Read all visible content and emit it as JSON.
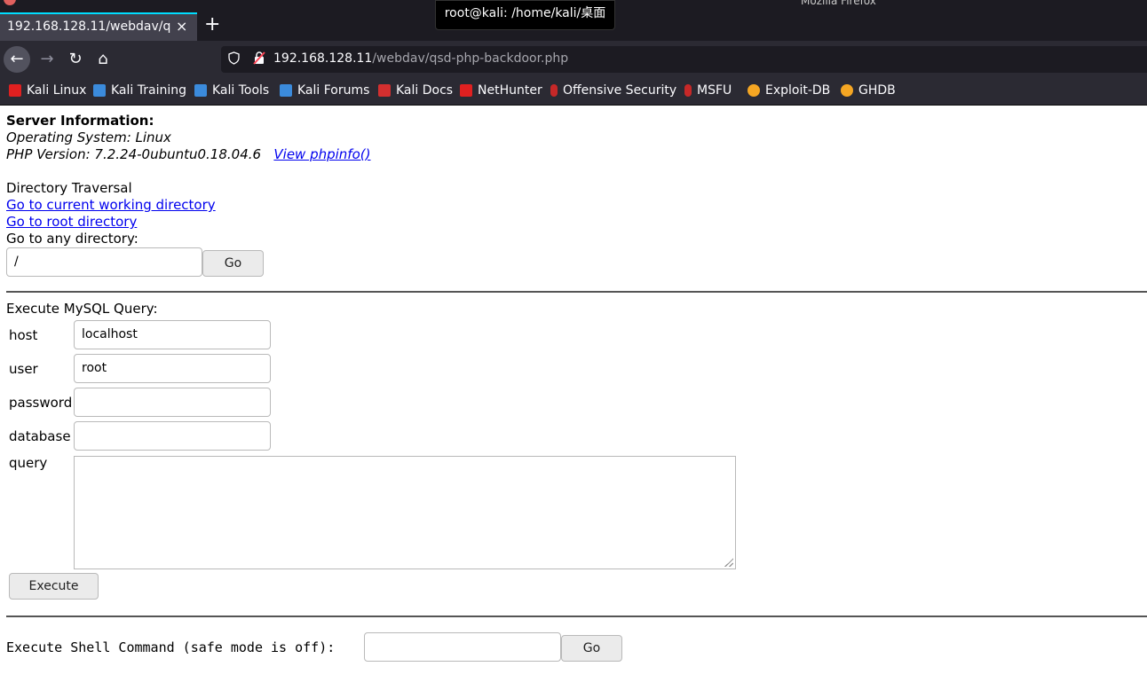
{
  "window": {
    "title": "Mozilla Firefox"
  },
  "tab": {
    "label": "192.168.128.11/webdav/qsd-php-backdoor.php",
    "close": "×",
    "new_tab": "+"
  },
  "tooltip": {
    "text": "root@kali: /home/kali/桌面"
  },
  "nav": {
    "back": "←",
    "forward": "→",
    "reload": "↻",
    "home": "⌂"
  },
  "url": {
    "host": "192.168.128.11",
    "path": "/webdav/qsd-php-backdoor.php"
  },
  "bookmarks": [
    {
      "label": "Kali Linux",
      "icon": "kali-dragon-icon",
      "color": "#e02020"
    },
    {
      "label": "Kali Training",
      "icon": "kali-training-icon",
      "color": "#3b8bdc"
    },
    {
      "label": "Kali Tools",
      "icon": "kali-tools-icon",
      "color": "#3b8bdc"
    },
    {
      "label": "Kali Forums",
      "icon": "kali-forums-icon",
      "color": "#3b8bdc"
    },
    {
      "label": "Kali Docs",
      "icon": "kali-docs-icon",
      "color": "#d32f2f"
    },
    {
      "label": "NetHunter",
      "icon": "nethunter-icon",
      "color": "#e02020"
    },
    {
      "label": "Offensive Security",
      "icon": "offsec-icon",
      "color": "#c62828"
    },
    {
      "label": "MSFU",
      "icon": "msfu-icon",
      "color": "#c62828"
    },
    {
      "label": "Exploit-DB",
      "icon": "exploitdb-icon",
      "color": "#f5a623"
    },
    {
      "label": "GHDB",
      "icon": "ghdb-icon",
      "color": "#f5a623"
    }
  ],
  "server": {
    "heading": "Server Information:",
    "os": "Operating System: Linux",
    "php": "PHP Version: 7.2.24-0ubuntu0.18.04.6",
    "phpinfo_link": "View phpinfo()"
  },
  "dir": {
    "heading": "Directory Traversal",
    "cwd_link": "Go to current working directory",
    "root_link": "Go to root directory",
    "any_label": "Go to any directory:",
    "path_value": "/",
    "go_label": "Go"
  },
  "mysql": {
    "heading": "Execute MySQL Query:",
    "host_label": "host",
    "host_value": "localhost",
    "user_label": "user",
    "user_value": "root",
    "password_label": "password",
    "password_value": "",
    "database_label": "database",
    "database_value": "",
    "query_label": "query",
    "query_value": "",
    "execute_label": "Execute"
  },
  "shell": {
    "label": "Execute Shell Command (safe mode is off):",
    "value": "",
    "go_label": "Go"
  }
}
